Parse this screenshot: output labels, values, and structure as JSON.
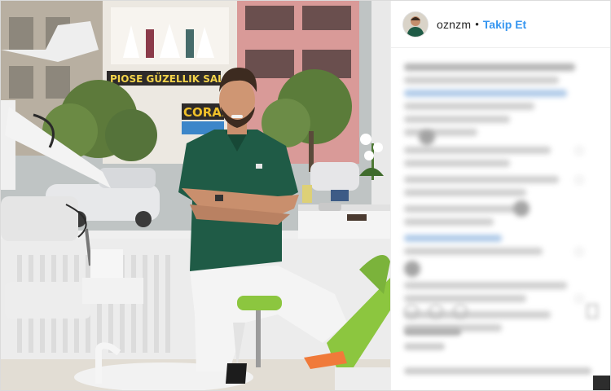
{
  "post": {
    "author": {
      "username": "oznzm"
    },
    "separator": "•",
    "follow_label": "Takip Et"
  },
  "photo": {
    "storefront_sign": "PIOSE GÜZELLIK SALON",
    "shop_sign": "CORAL"
  },
  "colors": {
    "follow": "#3897f0",
    "username": "#262626",
    "border": "#dbdbdb",
    "scrubs": "#1f5b46",
    "chair_green": "#8cc63f"
  }
}
